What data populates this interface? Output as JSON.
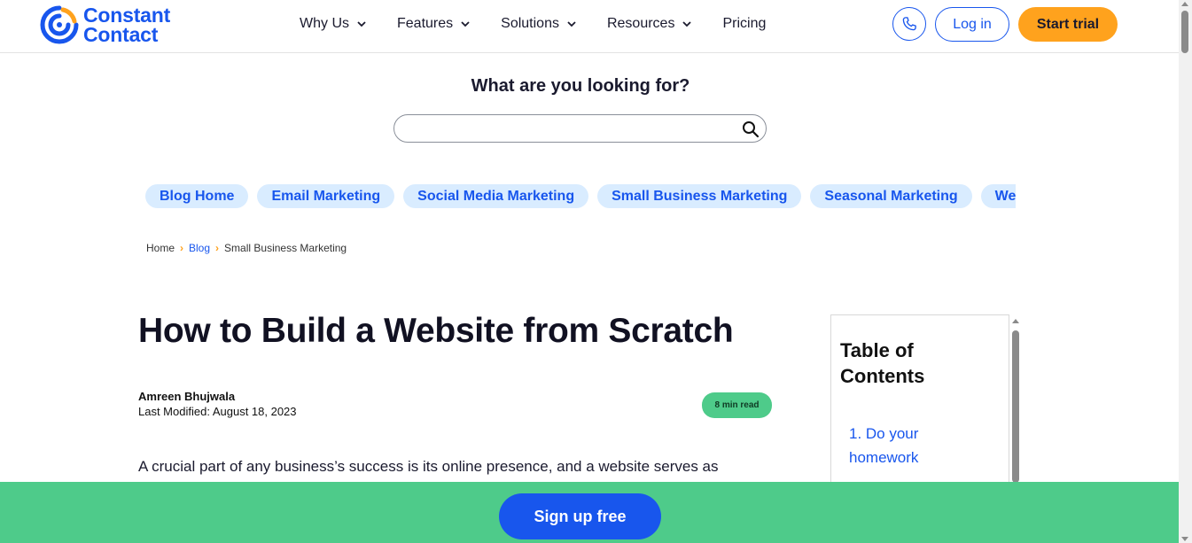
{
  "header": {
    "logo_line1": "Constant",
    "logo_line2": "Contact",
    "nav": [
      {
        "label": "Why Us"
      },
      {
        "label": "Features"
      },
      {
        "label": "Solutions"
      },
      {
        "label": "Resources"
      },
      {
        "label": "Pricing"
      }
    ],
    "login_label": "Log in",
    "trial_label": "Start trial",
    "phone_icon": "phone-icon"
  },
  "search": {
    "heading": "What are you looking for?",
    "value": "",
    "placeholder": "",
    "icon": "search-icon"
  },
  "categories": [
    "Blog Home",
    "Email Marketing",
    "Social Media Marketing",
    "Small Business Marketing",
    "Seasonal Marketing",
    "Web"
  ],
  "breadcrumb": {
    "items": [
      "Home",
      "Blog",
      "Small Business Marketing"
    ]
  },
  "article": {
    "title": "How to Build a Website from Scratch",
    "author": "Amreen Bhujwala",
    "last_modified": "Last Modified: August 18, 2023",
    "read_time": "8 min read",
    "intro": "A crucial part of any business’s success is its online presence, and a website serves as"
  },
  "toc": {
    "title": "Table of Contents",
    "items": [
      "1. Do your homework"
    ]
  },
  "footer_bar": {
    "signup_label": "Sign up free"
  },
  "colors": {
    "brand_blue": "#1856ed",
    "accent_orange": "#ffa21d",
    "green": "#4ecb8a",
    "pill_bg": "#d9ecff"
  }
}
